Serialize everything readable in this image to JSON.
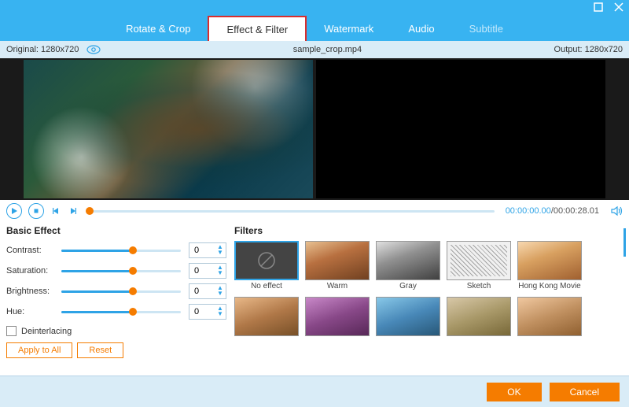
{
  "window": {
    "maximize": "maximize",
    "close": "close"
  },
  "tabs": [
    {
      "label": "Rotate & Crop",
      "active": false
    },
    {
      "label": "Effect & Filter",
      "active": true
    },
    {
      "label": "Watermark",
      "active": false
    },
    {
      "label": "Audio",
      "active": false
    },
    {
      "label": "Subtitle",
      "active": false,
      "muted": true
    }
  ],
  "infobar": {
    "original_label": "Original: 1280x720",
    "filename": "sample_crop.mp4",
    "output_label": "Output: 1280x720"
  },
  "playback": {
    "current": "00:00:00.00",
    "total": "00:00:28.01"
  },
  "basic_effect": {
    "title": "Basic Effect",
    "rows": [
      {
        "label": "Contrast:",
        "value": "0"
      },
      {
        "label": "Saturation:",
        "value": "0"
      },
      {
        "label": "Brightness:",
        "value": "0"
      },
      {
        "label": "Hue:",
        "value": "0"
      }
    ],
    "deinterlacing_label": "Deinterlacing",
    "apply_all": "Apply to All",
    "reset": "Reset"
  },
  "filters": {
    "title": "Filters",
    "items": [
      {
        "label": "No effect",
        "class": "no-effect",
        "selected": true
      },
      {
        "label": "Warm",
        "class": "th-warm"
      },
      {
        "label": "Gray",
        "class": "th-gray"
      },
      {
        "label": "Sketch",
        "class": "th-sketch"
      },
      {
        "label": "Hong Kong Movie",
        "class": "th-hk"
      },
      {
        "label": "",
        "class": "th-a"
      },
      {
        "label": "",
        "class": "th-b"
      },
      {
        "label": "",
        "class": "th-c"
      },
      {
        "label": "",
        "class": "th-d"
      },
      {
        "label": "",
        "class": "th-e"
      }
    ]
  },
  "footer": {
    "ok": "OK",
    "cancel": "Cancel"
  }
}
